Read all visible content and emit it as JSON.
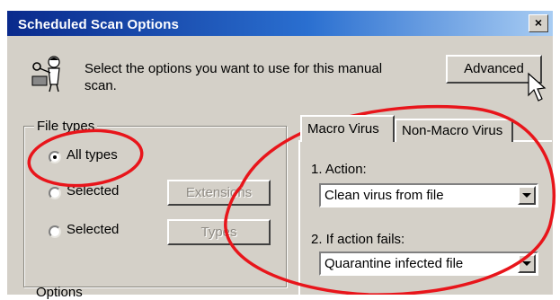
{
  "window": {
    "title": "Scheduled Scan Options",
    "close_glyph": "×"
  },
  "intro": {
    "text_line1": "Select the options you want to use for this manual",
    "text_line2": "scan.",
    "icon": "scanning-person-icon"
  },
  "advanced_button": {
    "label": "Advanced"
  },
  "file_types": {
    "group_label": "File types",
    "options": [
      {
        "label": "All types",
        "selected": true
      },
      {
        "label": "Selected",
        "selected": false
      },
      {
        "label": "Selected",
        "selected": false
      }
    ],
    "extensions_button": "Extensions",
    "types_button": "Types"
  },
  "tabs": [
    {
      "label": "Macro Virus",
      "active": true
    },
    {
      "label": "Non-Macro Virus",
      "active": false
    }
  ],
  "macro_virus": {
    "action_label": "1. Action:",
    "action_value": "Clean virus from file",
    "fallback_label": "2. If action fails:",
    "fallback_value": "Quarantine infected file"
  },
  "options_group": {
    "label": "Options"
  },
  "colors": {
    "annotation": "#e8151b",
    "dialog_bg": "#d4d0c8",
    "titlebar": "#0a2a8c"
  }
}
